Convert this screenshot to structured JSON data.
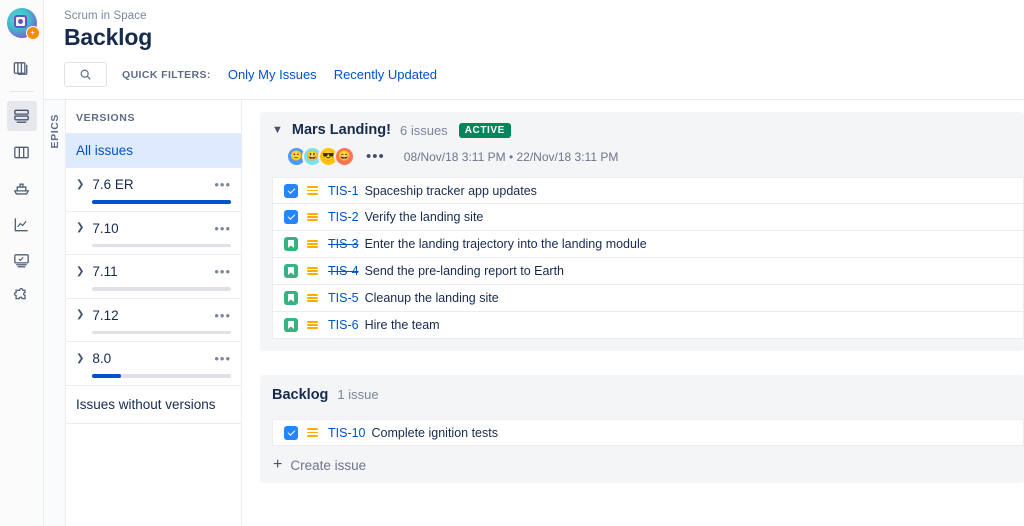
{
  "rail": {
    "project_avatar": {
      "name": "project-avatar",
      "badge": "✶"
    },
    "icons": [
      {
        "name": "boards-icon",
        "glyph": "boards"
      },
      {
        "name": "backlog-icon",
        "glyph": "backlog",
        "active": true
      },
      {
        "name": "board-icon",
        "glyph": "board"
      },
      {
        "name": "releases-icon",
        "glyph": "ship"
      },
      {
        "name": "reports-icon",
        "glyph": "chart"
      },
      {
        "name": "pages-icon",
        "glyph": "page"
      },
      {
        "name": "addons-icon",
        "glyph": "puzzle"
      }
    ]
  },
  "header": {
    "breadcrumb": "Scrum in Space",
    "title": "Backlog"
  },
  "filters": {
    "search_placeholder": "",
    "search_icon": "search-icon",
    "quick_filters_label": "QUICK FILTERS:",
    "links": [
      "Only My Issues",
      "Recently Updated"
    ]
  },
  "epics_tab": {
    "label": "EPICS"
  },
  "versions_panel": {
    "heading": "VERSIONS",
    "all_issues": "All issues",
    "rows": [
      {
        "name": "7.6 ER",
        "progress": 100,
        "menu": "•••"
      },
      {
        "name": "7.10",
        "progress": 0,
        "menu": "•••"
      },
      {
        "name": "7.11",
        "progress": 0,
        "menu": "•••"
      },
      {
        "name": "7.12",
        "progress": 0,
        "menu": "•••"
      },
      {
        "name": "8.0",
        "progress": 21,
        "menu": "•••"
      }
    ],
    "no_version": "Issues without versions"
  },
  "sprint": {
    "name": "Mars Landing!",
    "issue_count": "6 issues",
    "status_badge": "ACTIVE",
    "start_date": "08/Nov/18 3:11 PM",
    "date_separator": "•",
    "end_date": "22/Nov/18 3:11 PM",
    "more_menu": "•••",
    "avatars": [
      {
        "name": "avatar-1",
        "color": "#4C9AFF",
        "face": "🙂"
      },
      {
        "name": "avatar-2",
        "color": "#79E2F2",
        "face": "😃"
      },
      {
        "name": "avatar-3",
        "color": "#FFC400",
        "face": "😎"
      },
      {
        "name": "avatar-4",
        "color": "#FF7452",
        "face": "😄"
      }
    ],
    "issues": [
      {
        "type": "task",
        "key": "TIS-1",
        "summary": "Spaceship tracker app updates",
        "done": false
      },
      {
        "type": "task",
        "key": "TIS-2",
        "summary": "Verify the landing site",
        "done": false
      },
      {
        "type": "story",
        "key": "TIS-3",
        "summary": "Enter the landing trajectory into the landing module",
        "done": true
      },
      {
        "type": "story",
        "key": "TIS-4",
        "summary": "Send the pre-landing report to Earth",
        "done": true
      },
      {
        "type": "story",
        "key": "TIS-5",
        "summary": "Cleanup the landing site",
        "done": false
      },
      {
        "type": "story",
        "key": "TIS-6",
        "summary": "Hire the team",
        "done": false
      }
    ]
  },
  "backlog": {
    "name": "Backlog",
    "issue_count": "1 issue",
    "issues": [
      {
        "type": "task",
        "key": "TIS-10",
        "summary": "Complete ignition tests",
        "done": false
      }
    ],
    "create_issue": "Create issue",
    "create_plus": "+"
  },
  "colors": {
    "accent_blue": "#0052CC",
    "link_blue": "#0052CC",
    "task_blue": "#2684FF",
    "story_green": "#36B37E",
    "active_green": "#00875A",
    "priority_orange": "#ffab00",
    "selected_bg": "#deebff",
    "panel_bg": "#f4f5f7"
  }
}
